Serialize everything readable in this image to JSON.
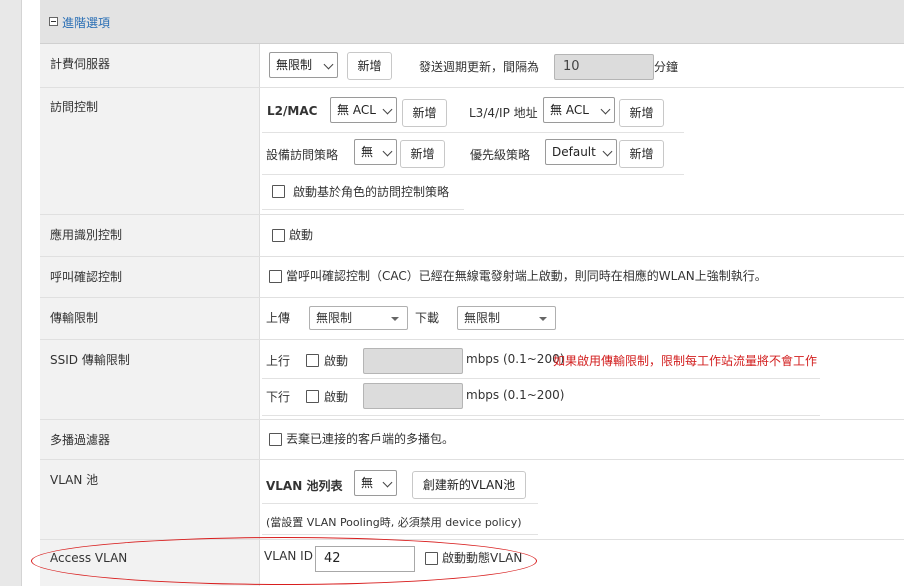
{
  "section": {
    "title": "進階選項"
  },
  "billing": {
    "label": "計費伺服器",
    "select_value": "無限制",
    "add_label": "新增",
    "interval_label": "發送週期更新，間隔為",
    "interval_value": "10",
    "unit": "分鐘"
  },
  "access_control": {
    "label": "訪問控制",
    "l2_label": "L2/MAC",
    "l2_value": "無 ACL",
    "l2_add": "新增",
    "l3_label": "L3/4/IP 地址",
    "l3_value": "無 ACL",
    "l3_add": "新增",
    "device_label": "設備訪問策略",
    "device_value": "無",
    "device_add": "新增",
    "priority_label": "優先級策略",
    "priority_value": "Default",
    "priority_add": "新增",
    "role_label": "啟動基於角色的訪問控制策略"
  },
  "app_id": {
    "label": "應用識別控制",
    "enable_label": "啟動"
  },
  "cac": {
    "label": "呼叫確認控制",
    "text": "當呼叫確認控制（CAC）已經在無線電發射端上啟動，則同時在相應的WLAN上強制執行。"
  },
  "rate": {
    "label": "傳輸限制",
    "up_label": "上傳",
    "up_value": "無限制",
    "down_label": "下載",
    "down_value": "無限制"
  },
  "ssid_rate": {
    "label": "SSID 傳輸限制",
    "up_label": "上行",
    "up_enable": "啟動",
    "up_unit": "mbps (0.1~200)",
    "warning": "如果啟用傳輸限制，限制每工作站流量將不會工作",
    "down_label": "下行",
    "down_enable": "啟動",
    "down_unit": "mbps (0.1~200)"
  },
  "multicast": {
    "label": "多播過濾器",
    "text": "丟棄已連接的客戶端的多播包。"
  },
  "vlan_pool": {
    "label": "VLAN 池",
    "list_label": "VLAN 池列表",
    "list_value": "無",
    "create_label": "創建新的VLAN池",
    "note": "(當設置 VLAN Pooling時, 必須禁用 device policy)"
  },
  "access_vlan": {
    "label": "Access VLAN",
    "vlan_id_label": "VLAN ID",
    "vlan_id_value": "42",
    "dynamic_label": "啟動動態VLAN"
  },
  "colors": {
    "highlight": "#d81e1e",
    "section_title": "#2a6fb5",
    "warning": "#d21e1e"
  }
}
